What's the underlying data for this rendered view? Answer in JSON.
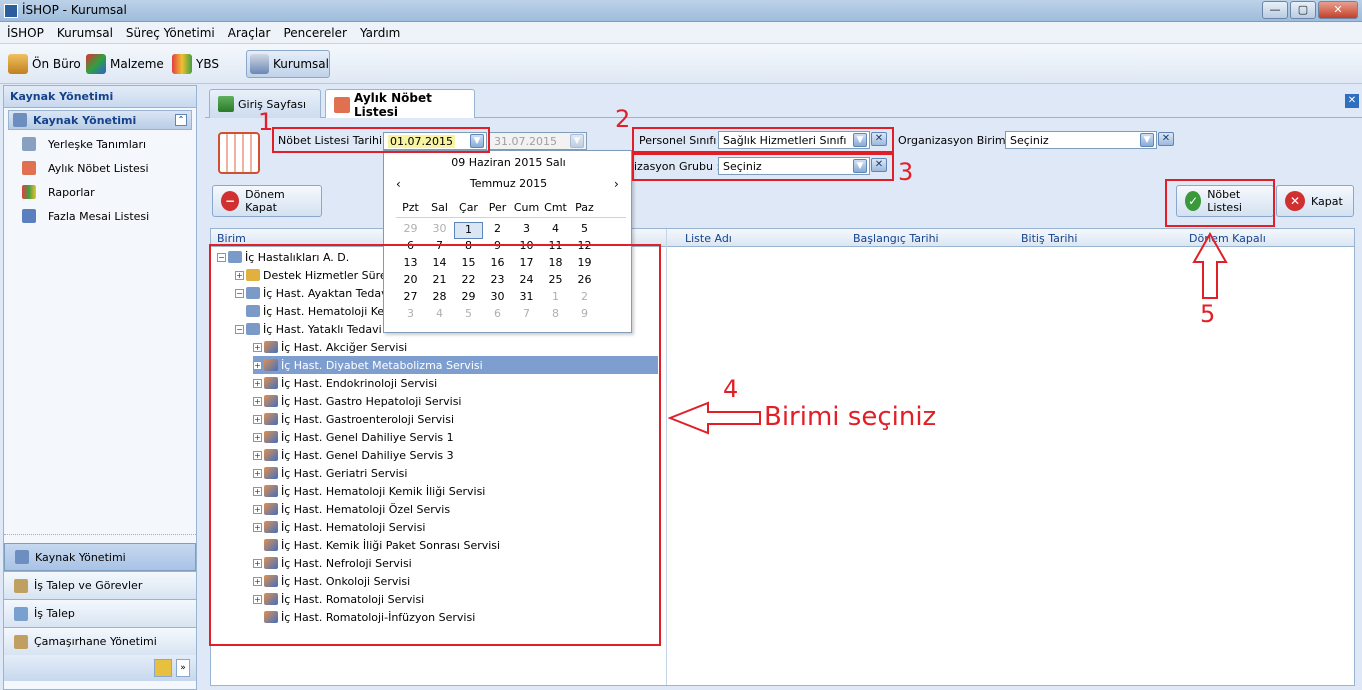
{
  "window": {
    "title": "İSHOP - Kurumsal",
    "controls": [
      "—",
      "▢",
      "✕"
    ]
  },
  "menu": [
    "İSHOP",
    "Kurumsal",
    "Süreç Yönetimi",
    "Araçlar",
    "Pencereler",
    "Yardım"
  ],
  "toolbar": {
    "items": [
      {
        "label": "Ön Büro",
        "icon": "front-office-icon"
      },
      {
        "label": "Malzeme",
        "icon": "material-icon"
      },
      {
        "label": "YBS",
        "icon": "chart-icon"
      },
      {
        "label": "Kurumsal",
        "icon": "corporate-icon"
      }
    ]
  },
  "sidebar": {
    "header": "Kaynak Yönetimi",
    "group": "Kaynak Yönetimi",
    "items": [
      {
        "label": "Yerleşke Tanımları"
      },
      {
        "label": "Aylık Nöbet Listesi"
      },
      {
        "label": "Raporlar"
      },
      {
        "label": "Fazla Mesai Listesi"
      }
    ],
    "bottom": [
      {
        "label": "Kaynak Yönetimi"
      },
      {
        "label": "İş Talep ve Görevler"
      },
      {
        "label": "İş Talep"
      },
      {
        "label": "Çamaşırhane Yönetimi"
      }
    ]
  },
  "tabs": [
    {
      "label": "Giriş Sayfası"
    },
    {
      "label": "Aylık Nöbet Listesi"
    }
  ],
  "form": {
    "date_label": "Nöbet Listesi Tarihi :",
    "date_from": "01.07.2015",
    "date_to": "31.07.2015",
    "personel_label": "Personel Sınıfı :",
    "personel_value": "Sağlık Hizmetleri Sınıfı",
    "org_label": "Organizasyon Birimi :",
    "org_value": "Seçiniz",
    "orggrp_label": "izasyon Grubu :",
    "orggrp_value": "Seçiniz",
    "donem_kapat": "Dönem Kapat",
    "nobet_listesi": "Nöbet Listesi",
    "kapat": "Kapat"
  },
  "calendar": {
    "today": "09 Haziran 2015 Salı",
    "month": "Temmuz 2015",
    "prev": "‹",
    "next": "›",
    "days": [
      "Pzt",
      "Sal",
      "Çar",
      "Per",
      "Cum",
      "Cmt",
      "Paz"
    ],
    "weeks": [
      [
        "29",
        "30",
        "1",
        "2",
        "3",
        "4",
        "5"
      ],
      [
        "6",
        "7",
        "8",
        "9",
        "10",
        "11",
        "12"
      ],
      [
        "13",
        "14",
        "15",
        "16",
        "17",
        "18",
        "19"
      ],
      [
        "20",
        "21",
        "22",
        "23",
        "24",
        "25",
        "26"
      ],
      [
        "27",
        "28",
        "29",
        "30",
        "31",
        "1",
        "2"
      ],
      [
        "3",
        "4",
        "5",
        "6",
        "7",
        "8",
        "9"
      ]
    ]
  },
  "grid": {
    "columns": [
      "Birim",
      "Liste Adı",
      "Başlangıç Tarihi",
      "Bitiş Tarihi",
      "Dönem Kapalı"
    ],
    "tree": [
      "İç Hastalıkları A. D.",
      "Destek Hizmetler Süreci",
      "İç Hast. Ayaktan Tedavi",
      "İç Hast. Hematoloji Kem",
      "İç Hast. Yataklı Tedavi S",
      "İç Hast. Akciğer Servisi",
      "İç Hast. Diyabet Metabolizma Servisi",
      "İç Hast. Endokrinoloji Servisi",
      "İç Hast. Gastro Hepatoloji Servisi",
      "İç Hast. Gastroenteroloji Servisi",
      "İç Hast. Genel Dahiliye Servis 1",
      "İç Hast. Genel Dahiliye Servis 3",
      "İç Hast. Geriatri Servisi",
      "İç Hast. Hematoloji Kemik İliği Servisi",
      "İç Hast. Hematoloji Özel Servis",
      "İç Hast. Hematoloji Servisi",
      "İç Hast. Kemik İliği Paket Sonrası Servisi",
      "İç Hast. Nefroloji Servisi",
      "İç Hast. Onkoloji Servisi",
      "İç Hast. Romatoloji Servisi",
      "İç Hast. Romatoloji-İnfüzyon Servisi"
    ]
  },
  "annotations": {
    "n1": "1",
    "n2": "2",
    "n3": "3",
    "n4": "4",
    "n5": "5",
    "hint": "Birimi seçiniz"
  },
  "colors": {
    "annotation": "#e21f26",
    "selection": "#7e9ed0",
    "accent": "#15428b"
  }
}
